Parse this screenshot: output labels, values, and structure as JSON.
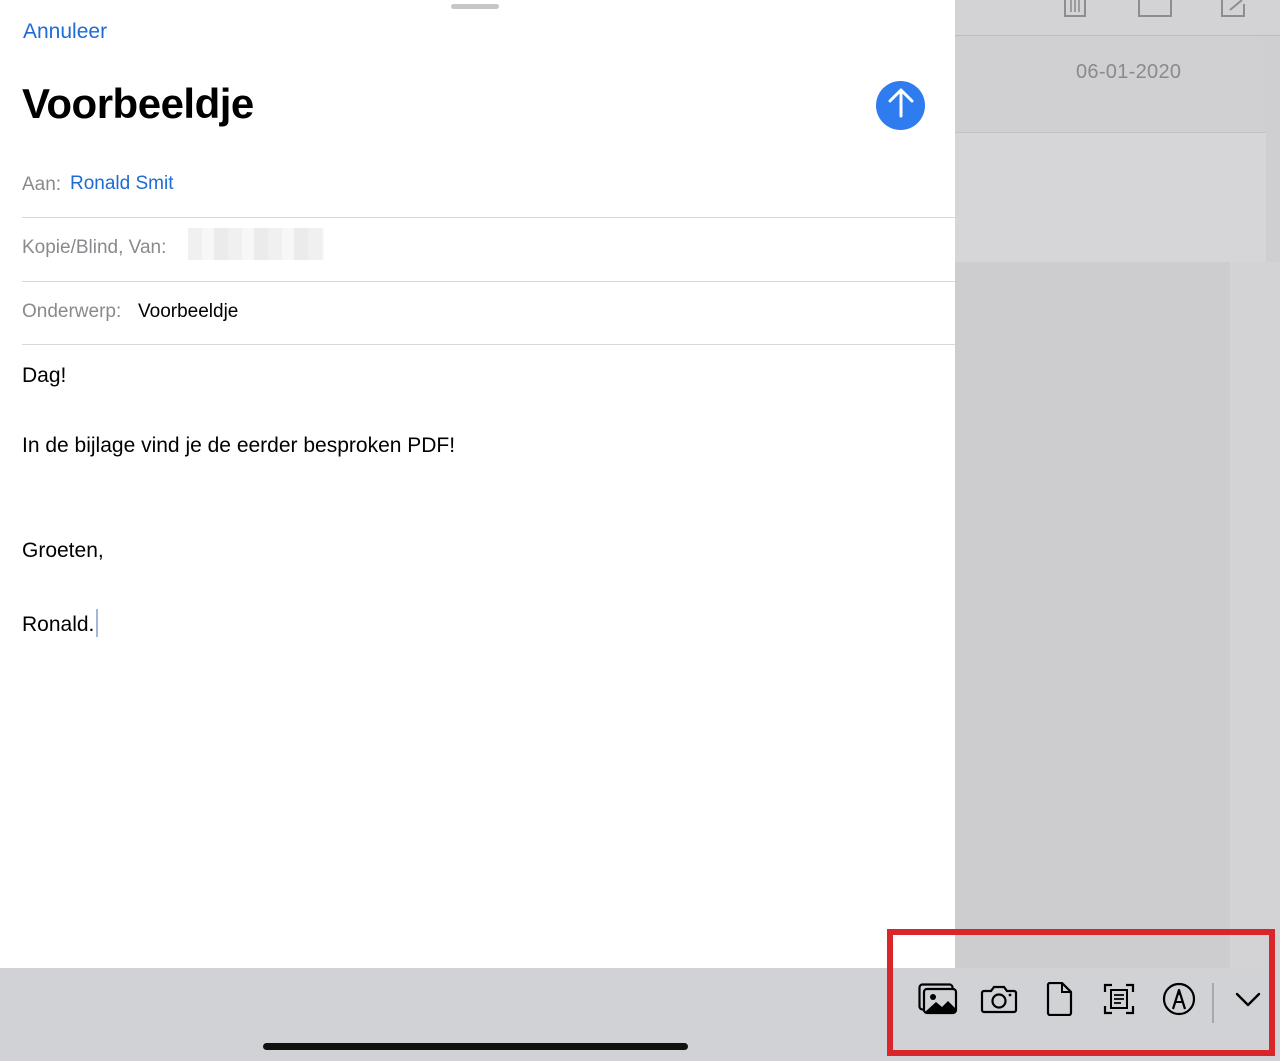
{
  "background": {
    "date": "06-01-2020",
    "icons": [
      "trash-icon",
      "folder-icon",
      "compose-icon"
    ]
  },
  "compose": {
    "cancel_label": "Annuleer",
    "title": "Voorbeeldje",
    "send_icon": "arrow-up-icon",
    "to": {
      "label": "Aan:",
      "value": "Ronald Smit"
    },
    "cc": {
      "label": "Kopie/Blind, Van:",
      "value_redacted": true
    },
    "subject": {
      "label": "Onderwerp:",
      "value": "Voorbeeldje"
    },
    "body": {
      "line1": "Dag!",
      "line2": "In de bijlage vind je de eerder besproken PDF!",
      "line3": "Groeten,",
      "line4": "Ronald."
    }
  },
  "toolbar": {
    "items": [
      {
        "name": "photo-library-icon"
      },
      {
        "name": "camera-icon"
      },
      {
        "name": "document-icon"
      },
      {
        "name": "scan-document-icon"
      },
      {
        "name": "markup-icon"
      },
      {
        "name": "chevron-down-icon"
      }
    ]
  },
  "colors": {
    "accent": "#1e6bd6",
    "send_button": "#2f7bf0",
    "highlight": "#d9262a",
    "toolbar_bg": "#d1d2d6"
  }
}
